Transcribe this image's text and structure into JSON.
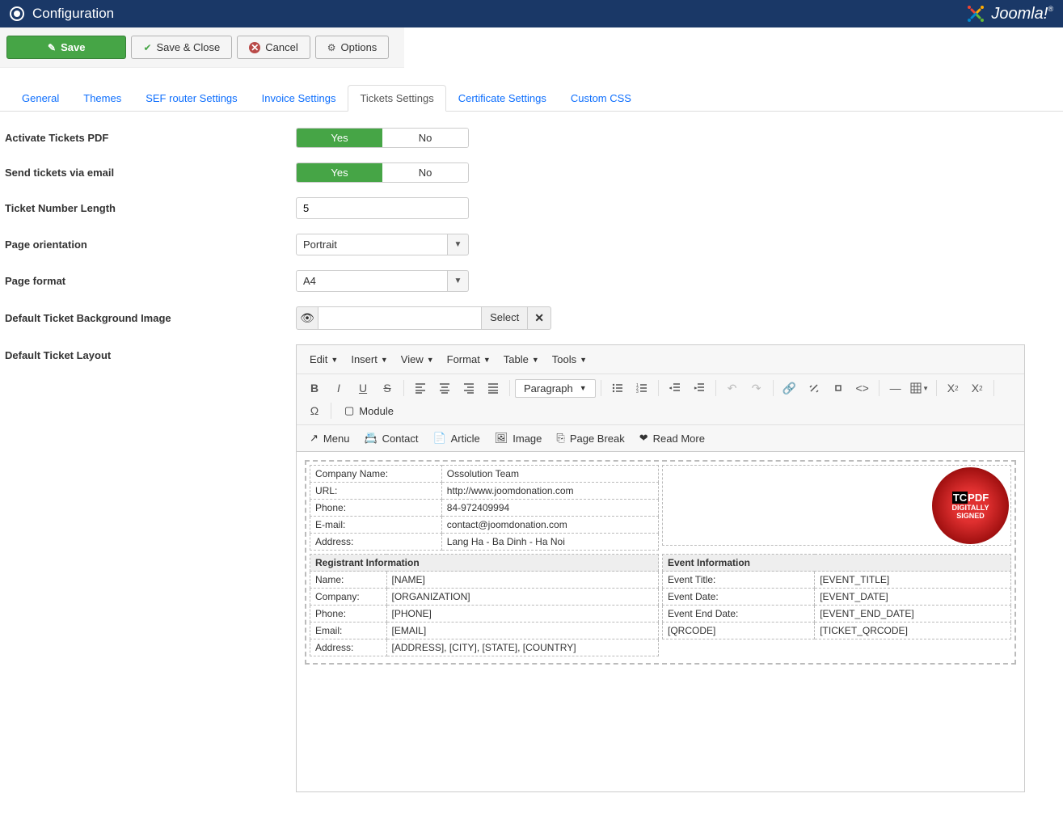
{
  "header": {
    "title": "Configuration",
    "brand": "Joomla!"
  },
  "toolbar": {
    "save": "Save",
    "save_close": "Save & Close",
    "cancel": "Cancel",
    "options": "Options"
  },
  "tabs": {
    "items": [
      {
        "label": "General"
      },
      {
        "label": "Themes"
      },
      {
        "label": "SEF router Settings"
      },
      {
        "label": "Invoice Settings"
      },
      {
        "label": "Tickets Settings"
      },
      {
        "label": "Certificate Settings"
      },
      {
        "label": "Custom CSS"
      }
    ]
  },
  "form": {
    "activate_label": "Activate Tickets PDF",
    "send_email_label": "Send tickets via email",
    "ticket_len_label": "Ticket Number Length",
    "ticket_len_value": "5",
    "orientation_label": "Page orientation",
    "orientation_value": "Portrait",
    "format_label": "Page format",
    "format_value": "A4",
    "bg_label": "Default Ticket Background Image",
    "bg_select": "Select",
    "layout_label": "Default Ticket Layout",
    "yes": "Yes",
    "no": "No"
  },
  "editor": {
    "menus": {
      "edit": "Edit",
      "insert": "Insert",
      "view": "View",
      "format": "Format",
      "table": "Table",
      "tools": "Tools"
    },
    "paragraph": "Paragraph",
    "module": "Module",
    "actions": {
      "menu": "Menu",
      "contact": "Contact",
      "article": "Article",
      "image": "Image",
      "page_break": "Page Break",
      "read_more": "Read More"
    }
  },
  "layout": {
    "company": {
      "rows": [
        {
          "k": "Company Name:",
          "v": "Ossolution Team"
        },
        {
          "k": "URL:",
          "v": "http://www.joomdonation.com"
        },
        {
          "k": "Phone:",
          "v": "84-972409994"
        },
        {
          "k": "E-mail:",
          "v": "contact@joomdonation.com"
        },
        {
          "k": "Address:",
          "v": "Lang Ha - Ba Dinh - Ha Noi"
        }
      ]
    },
    "registrant": {
      "header": "Registrant Information",
      "rows": [
        {
          "k": "Name:",
          "v": "[NAME]"
        },
        {
          "k": "Company:",
          "v": "[ORGANIZATION]"
        },
        {
          "k": "Phone:",
          "v": "[PHONE]"
        },
        {
          "k": "Email:",
          "v": "[EMAIL]"
        },
        {
          "k": "Address:",
          "v": "[ADDRESS], [CITY], [STATE], [COUNTRY]"
        }
      ]
    },
    "event": {
      "header": "Event Information",
      "rows": [
        {
          "k": "Event Title:",
          "v": "[EVENT_TITLE]"
        },
        {
          "k": "Event Date:",
          "v": "[EVENT_DATE]"
        },
        {
          "k": "Event End Date:",
          "v": "[EVENT_END_DATE]"
        },
        {
          "k": "[QRCODE]",
          "v": "[TICKET_QRCODE]"
        }
      ]
    },
    "seal": {
      "line1": "TCPDF",
      "line2": "DIGITALLY",
      "line3": "SIGNED"
    }
  }
}
